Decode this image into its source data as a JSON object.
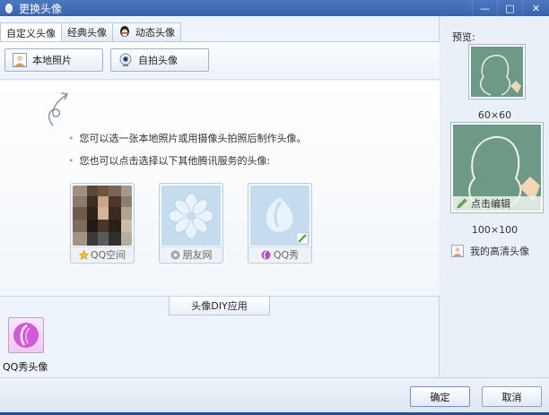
{
  "window": {
    "title": "更换头像",
    "min": "—",
    "max": "□",
    "close": "✕"
  },
  "tabs": [
    {
      "label": "自定义头像",
      "active": true
    },
    {
      "label": "经典头像",
      "active": false
    },
    {
      "label": "动态头像",
      "active": false
    }
  ],
  "toolbar": {
    "local_photo": "本地照片",
    "selfie": "自拍头像"
  },
  "tips": {
    "line1": "您可以选一张本地照片或用摄像头拍照后制作头像。",
    "line2": "您也可以点击选择以下其他腾讯服务的头像:"
  },
  "services": [
    {
      "label": "QQ空间"
    },
    {
      "label": "朋友网"
    },
    {
      "label": "QQ秀"
    }
  ],
  "diy": {
    "label": "头像DIY应用",
    "apps": [
      {
        "label": "QQ秀头像"
      }
    ]
  },
  "preview": {
    "label": "预览:",
    "small_size": "60×60",
    "large_size": "100×100",
    "edit": "点击编辑",
    "hd_avatar": "我的高清头像"
  },
  "buttons": {
    "ok": "确定",
    "cancel": "取消"
  },
  "colors": {
    "titlebar": "#3a63ad",
    "board_green": "#6d9a86",
    "qqshow_pink": "#d25ad8"
  }
}
